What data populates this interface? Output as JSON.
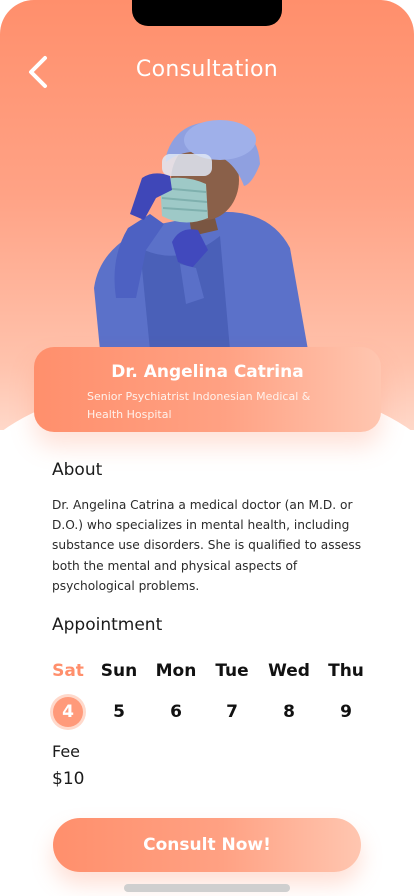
{
  "header": {
    "title": "Consultation",
    "back_icon": "chevron-left-icon"
  },
  "doctor": {
    "name": "Dr. Angelina Catrina",
    "role": "Senior Psychiatrist Indonesian Medical & Health Hospital"
  },
  "about": {
    "heading": "About",
    "text": "Dr. Angelina Catrina a medical doctor (an M.D. or D.O.) who specializes in mental health, including substance use disorders. She is qualified to assess both the mental and physical aspects of psychological problems."
  },
  "appointment": {
    "heading": "Appointment",
    "days": [
      {
        "label": "Sat",
        "date": "4",
        "selected": true
      },
      {
        "label": "Sun",
        "date": "5",
        "selected": false
      },
      {
        "label": "Mon",
        "date": "6",
        "selected": false
      },
      {
        "label": "Tue",
        "date": "7",
        "selected": false
      },
      {
        "label": "Wed",
        "date": "8",
        "selected": false
      },
      {
        "label": "Thu",
        "date": "9",
        "selected": false
      }
    ]
  },
  "fee": {
    "label": "Fee",
    "value": "$10"
  },
  "cta": {
    "label": "Consult Now!"
  },
  "colors": {
    "accent": "#ff8f6c",
    "accent_light": "#ffc6b0"
  }
}
